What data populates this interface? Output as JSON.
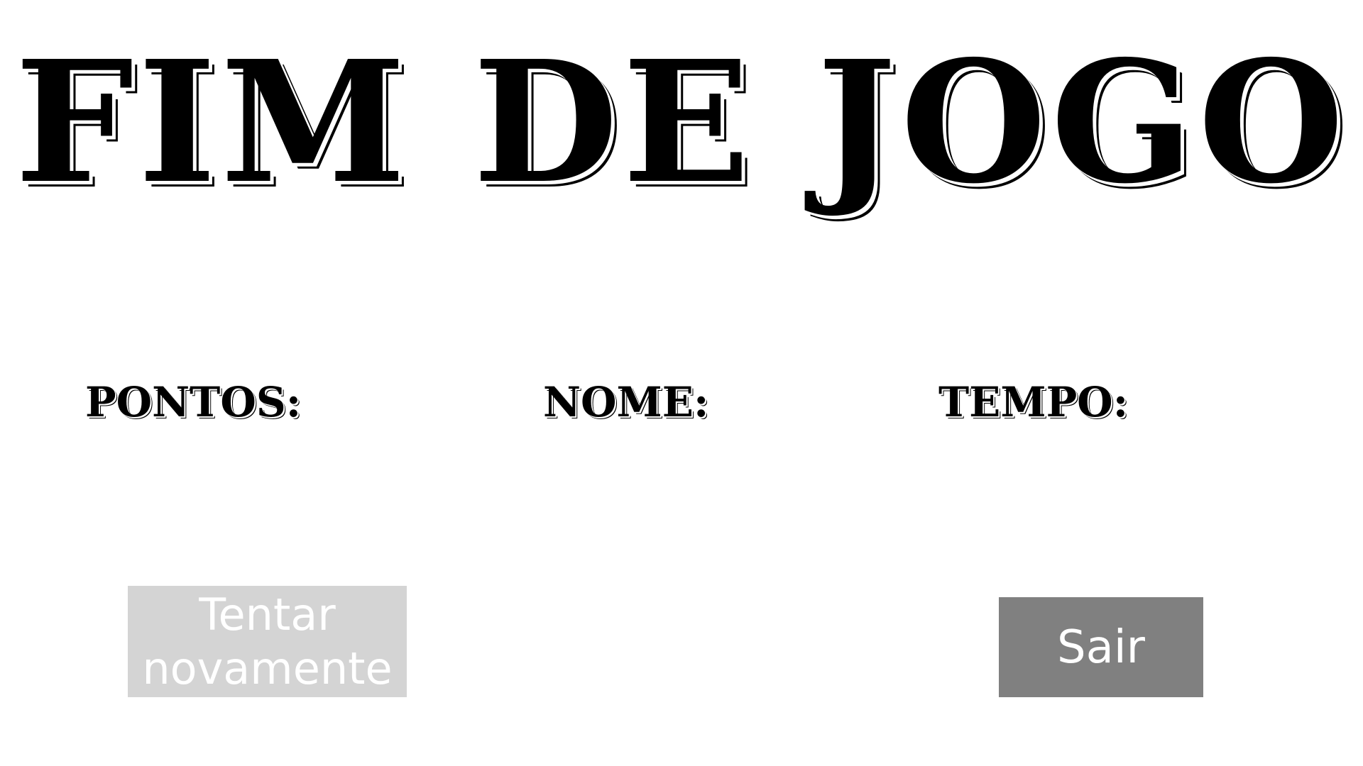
{
  "game_over": {
    "title": "FIM DE JOGO"
  },
  "stats": {
    "points_label": "PONTOS:",
    "name_label": "NOME:",
    "time_label": "TEMPO:"
  },
  "buttons": {
    "retry_label": "Tentar novamente",
    "exit_label": "Sair"
  },
  "colors": {
    "background": "#ffffff",
    "title_text": "#000000",
    "retry_button_bg": "#d4d4d4",
    "exit_button_bg": "#808080",
    "button_text": "#ffffff"
  }
}
